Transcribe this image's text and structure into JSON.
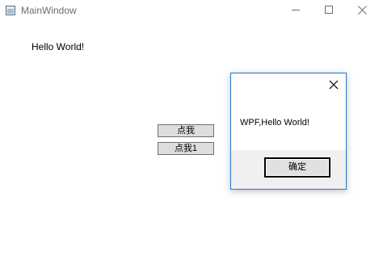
{
  "window": {
    "title": "MainWindow",
    "icon": "app-window-icon"
  },
  "caption_buttons": {
    "minimize": "minimize-icon",
    "maximize": "maximize-icon",
    "close": "close-icon"
  },
  "main": {
    "label": "Hello World!",
    "buttons": [
      {
        "label": "点我"
      },
      {
        "label": "点我1"
      }
    ]
  },
  "dialog": {
    "message": "WPF,Hello World!",
    "ok_label": "确定",
    "accent_color": "#1f7ad6"
  }
}
